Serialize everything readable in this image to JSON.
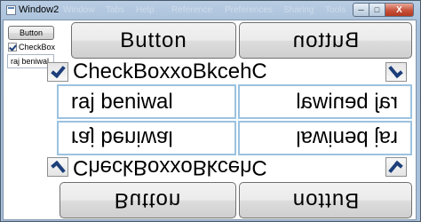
{
  "window": {
    "title": "Window2",
    "ghost_menu": [
      "Window",
      "Tabs",
      "Help",
      "Reference",
      "Preferences",
      "Sharing",
      "Tools"
    ],
    "caption": {
      "minimize": "─",
      "maximize": "□",
      "close": "X"
    }
  },
  "source": {
    "button_label": "Button",
    "checkbox_label": "CheckBox",
    "checkbox_checked": true,
    "textbox_value": "raj beniwal"
  },
  "reflections": {
    "button_label": "Button",
    "checkbox_label": "CheckBoxxoBkcehC",
    "textbox_value": "raj beniwal"
  },
  "colors": {
    "title_bar": "#a9c0da",
    "close_button": "#c8523b",
    "textbox_border": "#9bc2e0",
    "check_mark": "#1d3f7a"
  }
}
